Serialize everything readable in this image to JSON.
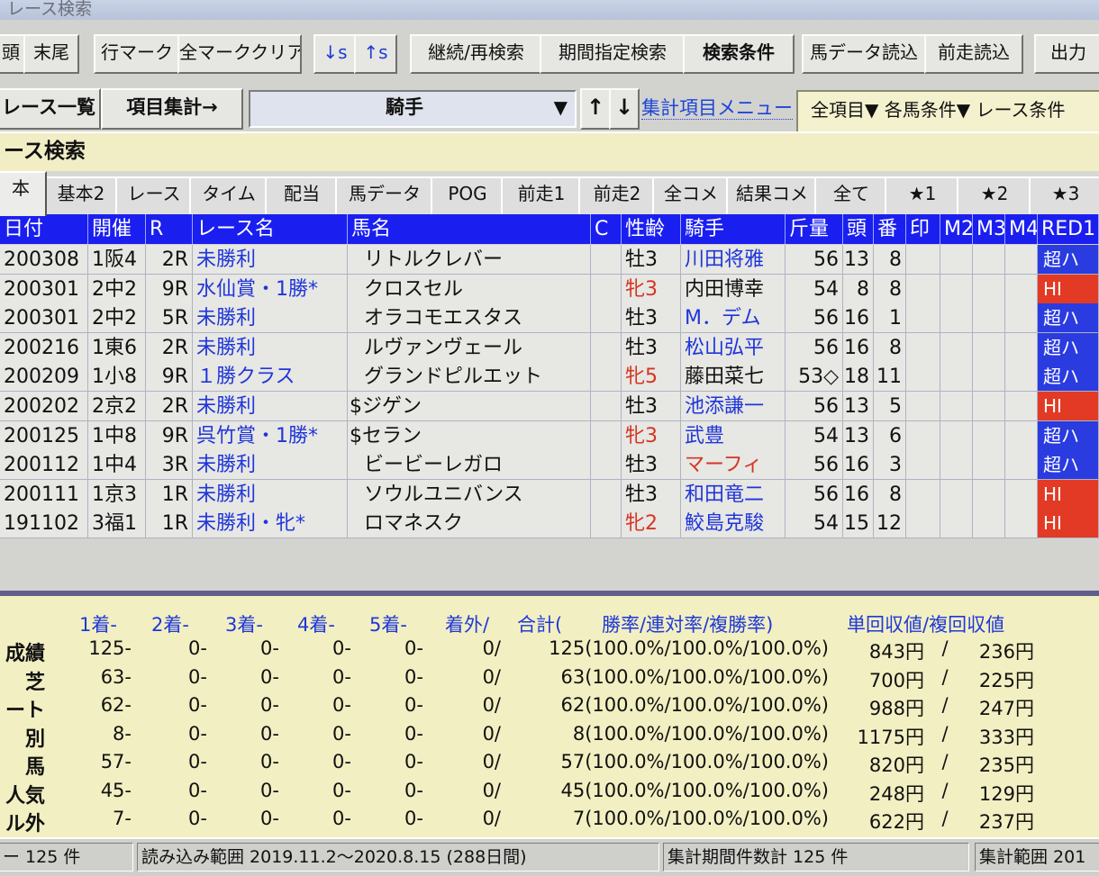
{
  "window": {
    "title": "レース検索"
  },
  "toolbar": {
    "buttons": [
      "頭",
      "末尾",
      "行マーク",
      "全マーククリア",
      "↓s",
      "↑s",
      "継続/再検索",
      "期間指定検索",
      "検索条件",
      "馬データ読込",
      "前走読込",
      "出力"
    ]
  },
  "row2": {
    "race_list": "レース一覧",
    "item_count": "項目集計→",
    "jockey_select": "騎手",
    "sort_up": "↑",
    "sort_down": "↓",
    "menu_link": "集計項目メニュー",
    "right_filter": "全項目▼ 各馬条件▼ レース条件"
  },
  "section": {
    "title": "ース検索"
  },
  "tabs": [
    "本",
    "基本2",
    "レース",
    "タイム",
    "配当",
    "馬データ",
    "POG",
    "前走1",
    "前走2",
    "全コメ",
    "結果コメ",
    "全て",
    "★1",
    "★2",
    "★3"
  ],
  "table": {
    "headers": [
      "日付",
      "開催",
      "R",
      "レース名",
      "馬名",
      "C",
      "性齢",
      "騎手",
      "斤量",
      "頭",
      "番",
      "印",
      "M2",
      "M3",
      "M4",
      "RED1"
    ],
    "rows": [
      {
        "date": "200308",
        "venue": "1阪4",
        "r": "2R",
        "race": "未勝利",
        "horse": "リトルクレバー",
        "c": "",
        "sex": "牡3",
        "jockey": "川田将雅",
        "weight": "56",
        "heads": "13",
        "num": "8",
        "red1": "超ハ"
      },
      {
        "date": "200301",
        "venue": "2中2",
        "r": "9R",
        "race": "水仙賞・1勝*",
        "horse": "クロスセル",
        "c": "",
        "sex": "牝3",
        "jockey": "内田博幸",
        "weight": "54",
        "heads": "8",
        "num": "8",
        "red1": "HI"
      },
      {
        "date": "200301",
        "venue": "2中2",
        "r": "5R",
        "race": "未勝利",
        "horse": "オラコモエスタス",
        "c": "",
        "sex": "牡3",
        "jockey": "M．デム",
        "weight": "56",
        "heads": "16",
        "num": "1",
        "red1": "超ハ"
      },
      {
        "date": "200216",
        "venue": "1東6",
        "r": "2R",
        "race": "未勝利",
        "horse": "ルヴァンヴェール",
        "c": "",
        "sex": "牡3",
        "jockey": "松山弘平",
        "weight": "56",
        "heads": "16",
        "num": "8",
        "red1": "超ハ"
      },
      {
        "date": "200209",
        "venue": "1小8",
        "r": "9R",
        "race": "１勝クラス",
        "horse": "グランドピルエット",
        "c": "",
        "sex": "牝5",
        "jockey": "藤田菜七",
        "weight": "53◇",
        "heads": "18",
        "num": "11",
        "red1": "超ハ"
      },
      {
        "date": "200202",
        "venue": "2京2",
        "r": "2R",
        "race": "未勝利",
        "horse": "$ジゲン",
        "c": "",
        "sex": "牡3",
        "jockey": "池添謙一",
        "weight": "56",
        "heads": "13",
        "num": "5",
        "red1": "HI"
      },
      {
        "date": "200125",
        "venue": "1中8",
        "r": "9R",
        "race": "呉竹賞・1勝*",
        "horse": "$セラン",
        "c": "",
        "sex": "牝3",
        "jockey": "武豊",
        "weight": "54",
        "heads": "13",
        "num": "6",
        "red1": "超ハ"
      },
      {
        "date": "200112",
        "venue": "1中4",
        "r": "3R",
        "race": "未勝利",
        "horse": "ビービーレガロ",
        "c": "",
        "sex": "牡3",
        "jockey": "マーフィ",
        "weight": "56",
        "heads": "16",
        "num": "3",
        "red1": "超ハ"
      },
      {
        "date": "200111",
        "venue": "1京3",
        "r": "1R",
        "race": "未勝利",
        "horse": "ソウルユニバンス",
        "c": "",
        "sex": "牡3",
        "jockey": "和田竜二",
        "weight": "56",
        "heads": "16",
        "num": "8",
        "red1": "HI"
      },
      {
        "date": "191102",
        "venue": "3福1",
        "r": "1R",
        "race": "未勝利・牝*",
        "horse": "ロマネスク",
        "c": "",
        "sex": "牝2",
        "jockey": "鮫島克駿",
        "weight": "54",
        "heads": "15",
        "num": "12",
        "red1": "HI"
      }
    ]
  },
  "stats": {
    "headers": [
      "1着-",
      "2着-",
      "3着-",
      "4着-",
      "5着-",
      "着外/",
      "合計(",
      "勝率/連対率/複勝率)",
      "単回収値/複回収値"
    ],
    "rows": [
      {
        "label": "成績",
        "w1": "125-",
        "w2": "0-",
        "w3": "0-",
        "w4": "0-",
        "w5": "0-",
        "out": "0/",
        "total": "125(100.0%/100.0%/100.0%)",
        "tan": "843円",
        "slash": "/",
        "fuku": "236円"
      },
      {
        "label": "芝",
        "w1": "63-",
        "w2": "0-",
        "w3": "0-",
        "w4": "0-",
        "w5": "0-",
        "out": "0/",
        "total": "63(100.0%/100.0%/100.0%)",
        "tan": "700円",
        "slash": "/",
        "fuku": "225円"
      },
      {
        "label": "ート",
        "w1": "62-",
        "w2": "0-",
        "w3": "0-",
        "w4": "0-",
        "w5": "0-",
        "out": "0/",
        "total": "62(100.0%/100.0%/100.0%)",
        "tan": "988円",
        "slash": "/",
        "fuku": "247円"
      },
      {
        "label": "別",
        "w1": "8-",
        "w2": "0-",
        "w3": "0-",
        "w4": "0-",
        "w5": "0-",
        "out": "0/",
        "total": "8(100.0%/100.0%/100.0%)",
        "tan": "1175円",
        "slash": "/",
        "fuku": "333円"
      },
      {
        "label": "馬",
        "w1": "57-",
        "w2": "0-",
        "w3": "0-",
        "w4": "0-",
        "w5": "0-",
        "out": "0/",
        "total": "57(100.0%/100.0%/100.0%)",
        "tan": "820円",
        "slash": "/",
        "fuku": "235円"
      },
      {
        "label": "人気",
        "w1": "45-",
        "w2": "0-",
        "w3": "0-",
        "w4": "0-",
        "w5": "0-",
        "out": "0/",
        "total": "45(100.0%/100.0%/100.0%)",
        "tan": "248円",
        "slash": "/",
        "fuku": "129円"
      },
      {
        "label": "ル外",
        "w1": "7-",
        "w2": "0-",
        "w3": "0-",
        "w4": "0-",
        "w5": "0-",
        "out": "0/",
        "total": "7(100.0%/100.0%/100.0%)",
        "tan": "622円",
        "slash": "/",
        "fuku": "237円"
      }
    ]
  },
  "statusbar": {
    "count": "ー 125 件",
    "range": "読み込み範囲 2019.11.2～2020.8.15 (288日間)",
    "period": "集計期間件数計 125 件",
    "agg": "集計範囲 201"
  },
  "colors": {
    "header_blue": "#1a1ff0",
    "badge_super": "#2a3be0",
    "badge_hi": "#e23a25",
    "stats_bg": "#f2efc2"
  }
}
